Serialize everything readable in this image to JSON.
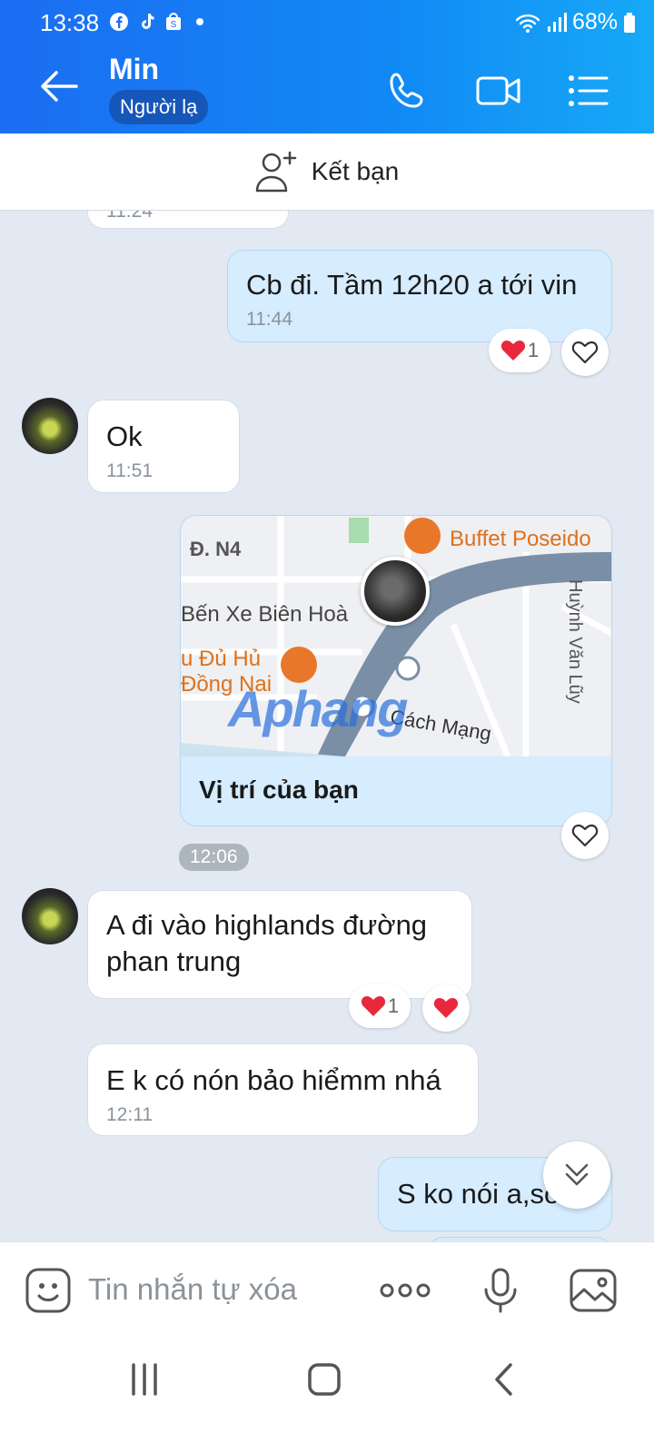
{
  "status_bar": {
    "time": "13:38",
    "battery": "68%"
  },
  "header": {
    "name": "Min",
    "badge": "Người lạ"
  },
  "friend_bar": {
    "label": "Kết bạn"
  },
  "messages": {
    "partial_time": "11:24",
    "m1": {
      "text": "Cb đi. Tầm 12h20 a tới vin",
      "time": "11:44",
      "reaction_count": "1"
    },
    "m2": {
      "text": "Ok",
      "time": "11:51"
    },
    "location": {
      "caption": "Vị trí của bạn",
      "time": "12:06",
      "labels": {
        "d_n4": "Đ. N4",
        "ben_xe": "Bến Xe Biên Hoà",
        "buffet": "Buffet Poseido",
        "huynh_van_luy": "Huỳnh Văn Lũy",
        "du_hu": "u Đủ Hủ",
        "dong_nai": "Đồng Nai",
        "cach_mang": "Cách Mạng",
        "watermark": "Aphang"
      }
    },
    "m3": {
      "line1": "A đi vào highlands đường",
      "line2": "phan trung",
      "reaction_count": "1"
    },
    "m4": {
      "text": "E k có nón bảo hiểmm nhá",
      "time": "12:11"
    },
    "m5": {
      "text": "S ko nói a,sớ"
    }
  },
  "input": {
    "placeholder": "Tin nhắn tự xóa"
  },
  "colors": {
    "accent": "#1189f5",
    "out_bubble": "#d6ecff",
    "heart": "#e8283c"
  }
}
